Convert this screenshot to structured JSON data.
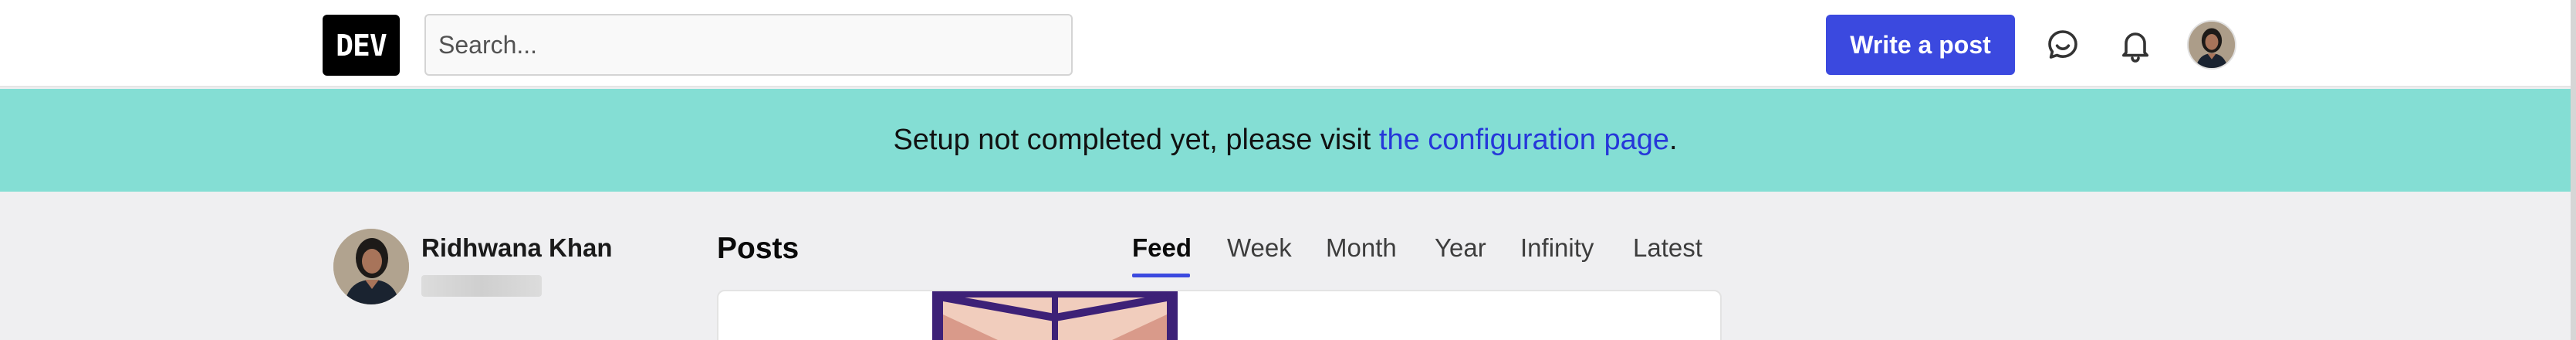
{
  "header": {
    "logo_text": "DEV",
    "search_placeholder": "Search...",
    "write_post_label": "Write a post",
    "icons": [
      "chat-icon",
      "bell-icon"
    ]
  },
  "banner": {
    "text_before": "Setup not completed yet, please visit ",
    "link_text": "the configuration page",
    "text_after": "."
  },
  "user": {
    "name": "Ridhwana Khan"
  },
  "main": {
    "title": "Posts",
    "tabs": [
      "Feed",
      "Week",
      "Month",
      "Year",
      "Infinity",
      "Latest"
    ],
    "active_tab": "Feed"
  },
  "colors": {
    "accent": "#3b49df",
    "banner_bg": "#84ded4",
    "link": "#2637d9",
    "page_bg": "#efeff1"
  }
}
